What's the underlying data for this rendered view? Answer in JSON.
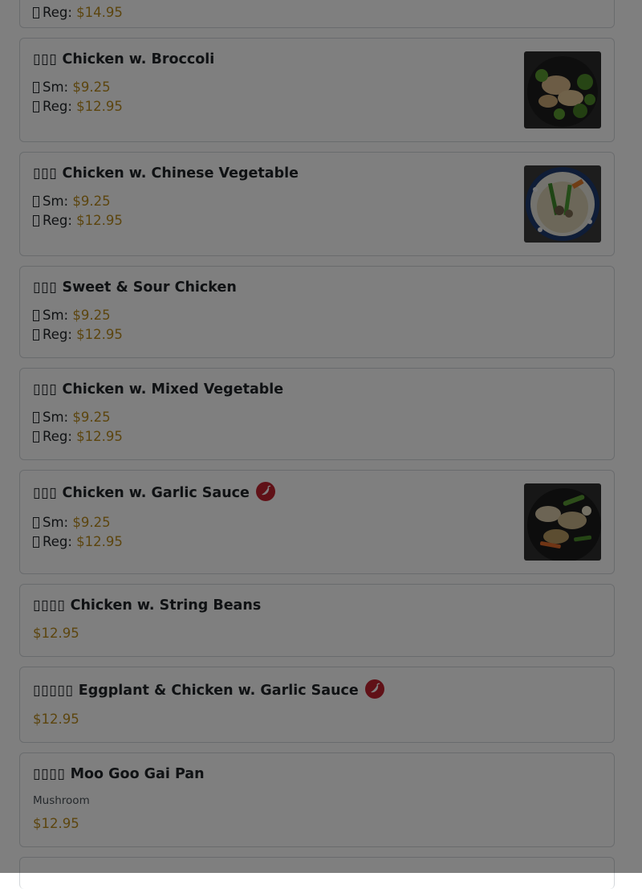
{
  "colors": {
    "price": "#b98a1d",
    "spicy": "#c0232f",
    "overlay": "rgba(0,0,0,0.5)"
  },
  "top_partial": {
    "size_label": "Reg:",
    "price": "$14.95"
  },
  "items": [
    {
      "zh": "▯▯▯",
      "name": "Chicken w. Broccoli",
      "sizes": [
        {
          "label": "Sm:",
          "price": "$9.25"
        },
        {
          "label": "Reg:",
          "price": "$12.95"
        }
      ],
      "has_image": true,
      "image_icon": "chicken-broccoli-photo"
    },
    {
      "zh": "▯▯▯",
      "name": "Chicken w. Chinese Vegetable",
      "sizes": [
        {
          "label": "Sm:",
          "price": "$9.25"
        },
        {
          "label": "Reg:",
          "price": "$12.95"
        }
      ],
      "has_image": true,
      "image_icon": "chicken-chinese-vegetable-photo"
    },
    {
      "zh": "▯▯▯",
      "name": "Sweet & Sour Chicken",
      "sizes": [
        {
          "label": "Sm:",
          "price": "$9.25"
        },
        {
          "label": "Reg:",
          "price": "$12.95"
        }
      ]
    },
    {
      "zh": "▯▯▯",
      "name": "Chicken w. Mixed Vegetable",
      "sizes": [
        {
          "label": "Sm:",
          "price": "$9.25"
        },
        {
          "label": "Reg:",
          "price": "$12.95"
        }
      ]
    },
    {
      "zh": "▯▯▯",
      "name": "Chicken w. Garlic Sauce",
      "spicy": true,
      "sizes": [
        {
          "label": "Sm:",
          "price": "$9.25"
        },
        {
          "label": "Reg:",
          "price": "$12.95"
        }
      ],
      "has_image": true,
      "image_icon": "chicken-garlic-sauce-photo"
    },
    {
      "zh": "▯▯▯▯",
      "name": "Chicken w. String Beans",
      "price": "$12.95"
    },
    {
      "zh": "▯▯▯▯▯",
      "name": "Eggplant & Chicken w. Garlic Sauce",
      "spicy": true,
      "price": "$12.95"
    },
    {
      "zh": "▯▯▯▯",
      "name": "Moo Goo Gai Pan",
      "description": "Mushroom",
      "price": "$12.95"
    }
  ],
  "icons": {
    "spicy": "chili-pepper-icon"
  }
}
